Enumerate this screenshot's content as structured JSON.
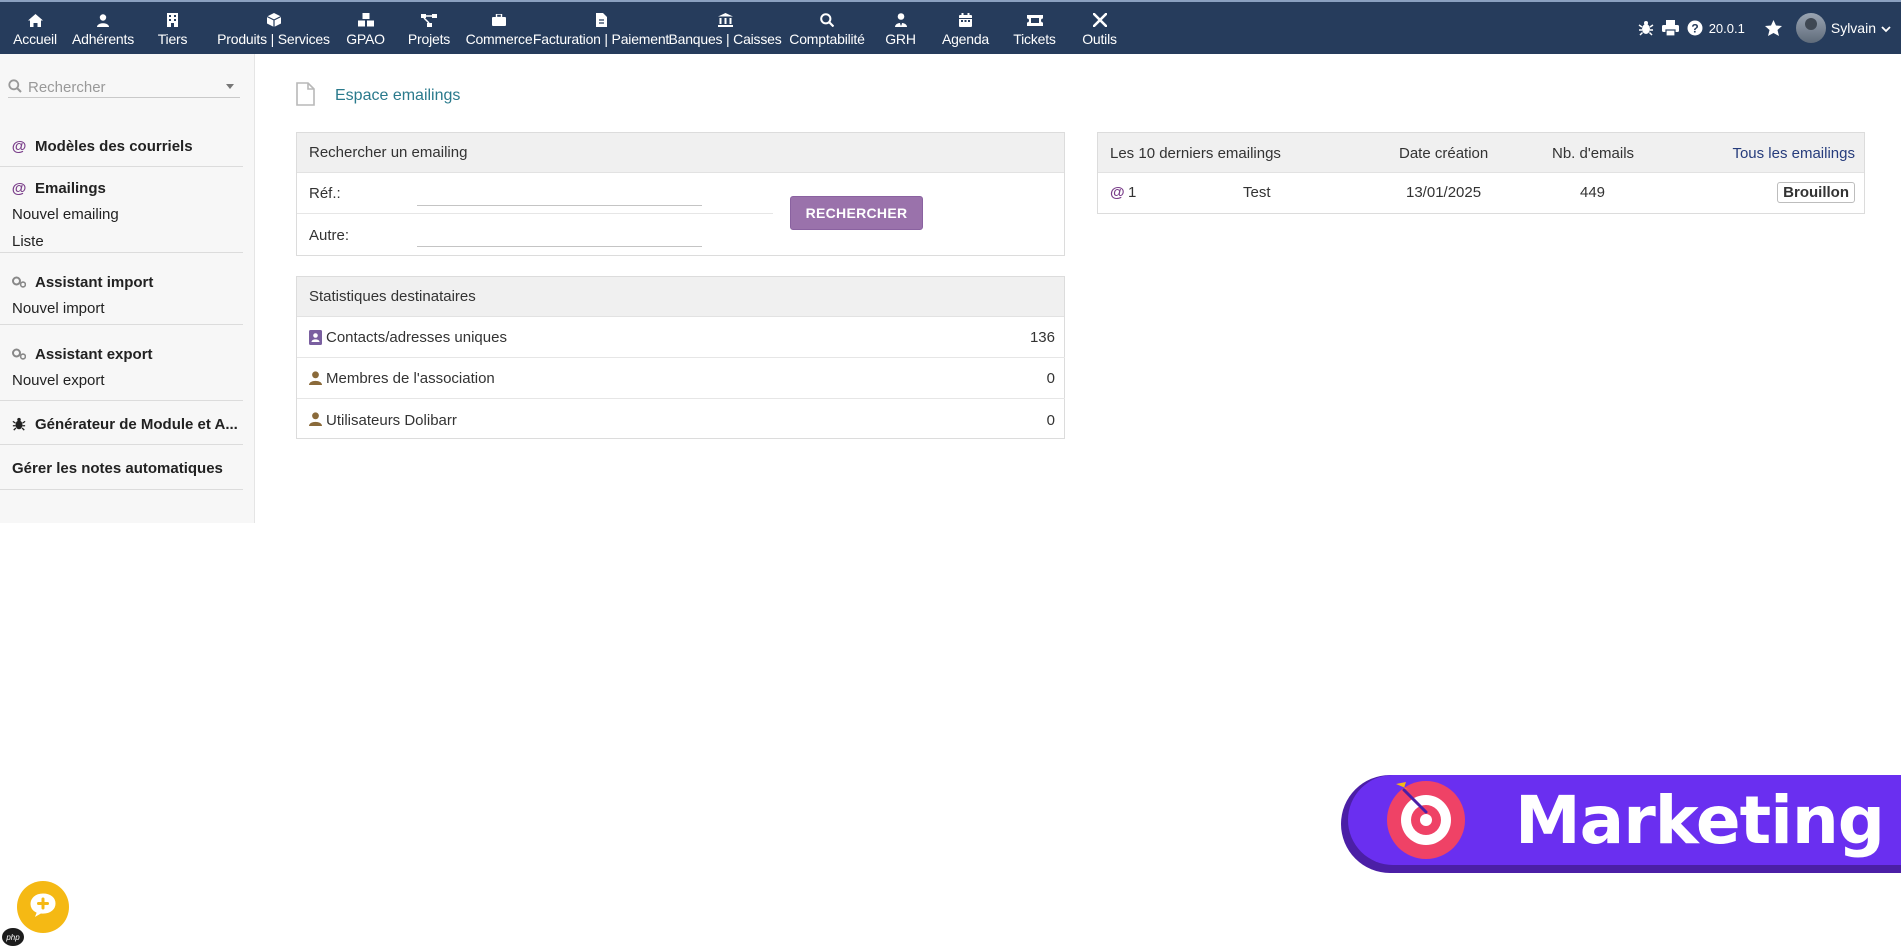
{
  "topbar": {
    "menu": [
      {
        "label": "Accueil",
        "icon": "home-icon"
      },
      {
        "label": "Adhérents",
        "icon": "user-icon"
      },
      {
        "label": "Tiers",
        "icon": "building-icon"
      },
      {
        "label": "Produits | Services",
        "icon": "cube-icon"
      },
      {
        "label": "GPAO",
        "icon": "cubes-icon"
      },
      {
        "label": "Projets",
        "icon": "project-diagram-icon"
      },
      {
        "label": "Commerce",
        "icon": "suitcase-icon"
      },
      {
        "label": "Facturation | Paiement",
        "icon": "invoice-file-icon"
      },
      {
        "label": "Banques | Caisses",
        "icon": "bank-icon"
      },
      {
        "label": "Comptabilité",
        "icon": "search-dollar-icon"
      },
      {
        "label": "GRH",
        "icon": "user-tie-icon"
      },
      {
        "label": "Agenda",
        "icon": "calendar-icon"
      },
      {
        "label": "Tickets",
        "icon": "ticket-icon"
      },
      {
        "label": "Outils",
        "icon": "tools-icon"
      }
    ],
    "version": "20.0.1",
    "user": "Sylvain"
  },
  "sidebar": {
    "search_placeholder": "Rechercher",
    "blocks": [
      {
        "title": "Modèles des courriels",
        "icon": "at-icon",
        "links": []
      },
      {
        "title": "Emailings",
        "icon": "at-icon",
        "links": [
          "Nouvel emailing",
          "Liste"
        ]
      },
      {
        "title": "Assistant import",
        "icon": "cogs-icon",
        "links": [
          "Nouvel import"
        ]
      },
      {
        "title": "Assistant export",
        "icon": "cogs-icon",
        "links": [
          "Nouvel export"
        ]
      },
      {
        "title": "Générateur de Module et A...",
        "icon": "bug-icon",
        "links": []
      },
      {
        "title": "Gérer les notes automatiques",
        "icon": "",
        "links": []
      }
    ]
  },
  "main": {
    "page_title": "Espace emailings",
    "search_box": {
      "title": "Rechercher un emailing",
      "ref_label": "Réf.:",
      "other_label": "Autre:",
      "button": "RECHERCHER"
    },
    "stats": {
      "title": "Statistiques destinataires",
      "rows": [
        {
          "label": "Contacts/adresses uniques",
          "value": "136"
        },
        {
          "label": "Membres de l'association",
          "value": "0"
        },
        {
          "label": "Utilisateurs Dolibarr",
          "value": "0"
        }
      ]
    },
    "latest": {
      "title": "Les 10 derniers emailings",
      "col_date": "Date création",
      "col_count": "Nb. d'emails",
      "all_link": "Tous les emailings",
      "rows": [
        {
          "ref": "1",
          "name": "Test",
          "date": "13/01/2025",
          "count": "449",
          "status": "Brouillon"
        }
      ]
    }
  },
  "overlay": {
    "banner_text": "Marketing",
    "php_badge": "php"
  },
  "colors": {
    "topbar": "#263c5c",
    "link": "#2a7a8c",
    "button": "#9a72ab",
    "banner": "#6a2ff0",
    "target": "#ef4266",
    "chat": "#f5b914"
  }
}
